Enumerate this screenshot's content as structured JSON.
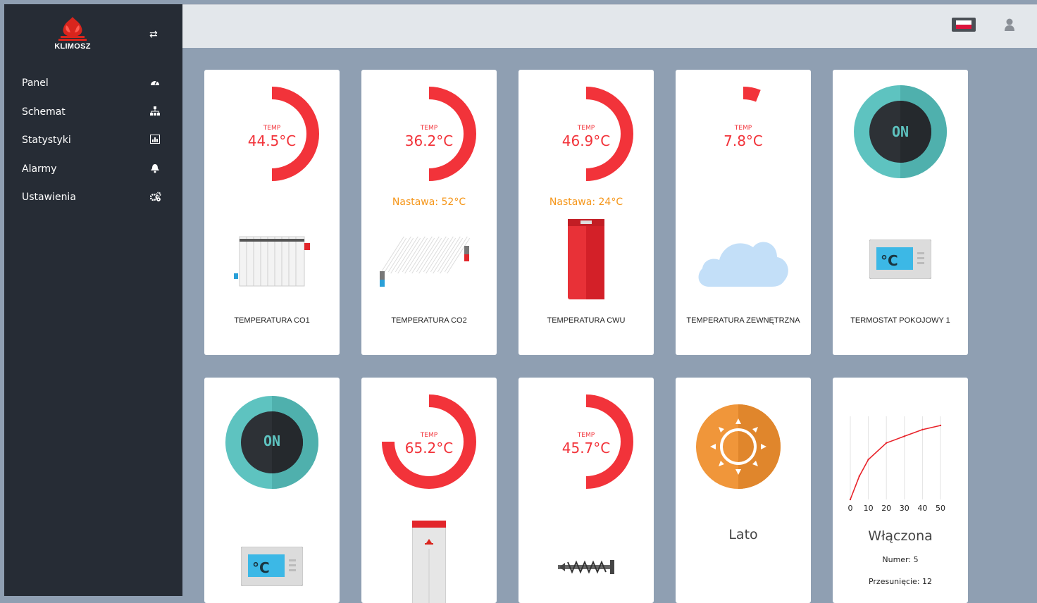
{
  "brand": {
    "name": "KLIMOSZ",
    "logo_icon": "flame-logo-icon",
    "color": "#d9251d"
  },
  "sidebar": {
    "background": "#262c35",
    "items": [
      {
        "label": "Panel",
        "icon": "dashboard-icon"
      },
      {
        "label": "Schemat",
        "icon": "sitemap-icon"
      },
      {
        "label": "Statystyki",
        "icon": "bar-chart-icon"
      },
      {
        "label": "Alarmy",
        "icon": "bell-icon"
      },
      {
        "label": "Ustawienia",
        "icon": "gears-icon"
      }
    ]
  },
  "header": {
    "language_flag": "poland-flag-icon",
    "user_icon": "user-icon"
  },
  "colors": {
    "accent_red": "#f2333a",
    "setpoint_orange": "#f5961a",
    "thermostat_teal": "#5ec3c0",
    "sun_orange": "#f0963a"
  },
  "cards": [
    {
      "type": "temp",
      "temp_label": "TEMP",
      "value": "44.5°C",
      "gauge_fraction": 0.5,
      "title": "TEMPERATURA CO1",
      "image": "radiator-icon"
    },
    {
      "type": "temp",
      "temp_label": "TEMP",
      "value": "36.2°C",
      "gauge_fraction": 0.5,
      "setpoint": "Nastawa: 52°C",
      "title": "TEMPERATURA CO2",
      "image": "floor-heating-icon"
    },
    {
      "type": "temp",
      "temp_label": "TEMP",
      "value": "46.9°C",
      "gauge_fraction": 0.5,
      "setpoint": "Nastawa: 24°C",
      "title": "TEMPERATURA CWU",
      "image": "water-tank-icon"
    },
    {
      "type": "temp",
      "temp_label": "TEMP",
      "value": "7.8°C",
      "gauge_fraction": 0.06,
      "title": "TEMPERATURA ZEWNĘTRZNA",
      "image": "cloud-icon"
    },
    {
      "type": "thermostat",
      "state": "ON",
      "title": "TERMOSTAT POKOJOWY 1",
      "image": "room-thermostat-icon"
    },
    {
      "type": "thermostat",
      "state": "ON",
      "image": "room-thermostat-icon"
    },
    {
      "type": "temp",
      "temp_label": "TEMP",
      "value": "65.2°C",
      "gauge_fraction": 0.75,
      "image": "boiler-icon"
    },
    {
      "type": "temp",
      "temp_label": "TEMP",
      "value": "45.7°C",
      "gauge_fraction": 0.5,
      "image": "feeder-screw-icon"
    },
    {
      "type": "season",
      "label": "Lato",
      "image": "sun-icon"
    },
    {
      "type": "curve",
      "label": "Włączona",
      "number": "Numer: 5",
      "offset": "Przesunięcie: 12"
    }
  ],
  "chart_data": {
    "type": "line",
    "x": [
      0,
      5,
      10,
      20,
      30,
      40,
      50
    ],
    "y": [
      0,
      28,
      48,
      68,
      76,
      84,
      89
    ],
    "xticks": [
      "0",
      "10",
      "20",
      "30",
      "40",
      "50"
    ],
    "xlim": [
      0,
      50
    ],
    "ylim": [
      0,
      100
    ],
    "grid": true,
    "title": "",
    "xlabel": "",
    "ylabel": ""
  }
}
